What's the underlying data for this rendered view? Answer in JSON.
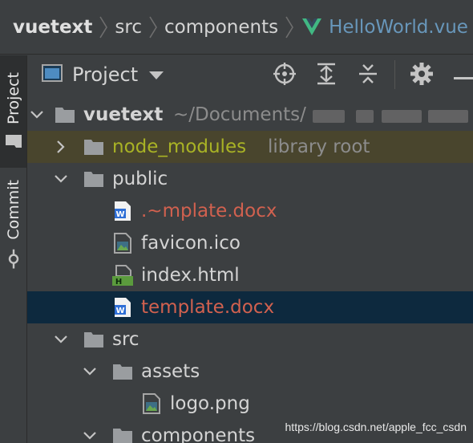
{
  "breadcrumb": {
    "items": [
      "vuetext",
      "src",
      "components",
      "HelloWorld.vue"
    ],
    "active_icon": "vue-logo-icon"
  },
  "tool_strip": {
    "project_label": "Project",
    "commit_label": "Commit"
  },
  "project_header": {
    "title": "Project",
    "view_icon": "project-view-icon",
    "actions": [
      "locate-icon",
      "expand-all-icon",
      "collapse-all-icon",
      "gear-icon",
      "hide-icon"
    ]
  },
  "tree": {
    "root": {
      "name": "vuetext",
      "path": "~/Documents/"
    },
    "rows": [
      {
        "name": "node_modules",
        "suffix": "library root",
        "kind": "folder-excluded",
        "state": "collapsed"
      },
      {
        "name": "public",
        "kind": "folder",
        "state": "expanded"
      },
      {
        "name": ".~mplate.docx",
        "kind": "word-file",
        "status": "unversioned"
      },
      {
        "name": "favicon.ico",
        "kind": "image-file"
      },
      {
        "name": "index.html",
        "kind": "html-file"
      },
      {
        "name": "template.docx",
        "kind": "word-file",
        "status": "unversioned",
        "selected": true
      },
      {
        "name": "src",
        "kind": "folder",
        "state": "expanded"
      },
      {
        "name": "assets",
        "kind": "folder",
        "state": "expanded"
      },
      {
        "name": "logo.png",
        "kind": "image-file"
      },
      {
        "name": "components",
        "kind": "folder",
        "state": "expanded"
      }
    ]
  },
  "colors": {
    "background": "#3c3f41",
    "selection": "#0d293e",
    "excluded_row": "#49452d",
    "unversioned_text": "#d1614f",
    "excluded_text": "#a9b325",
    "active_file_text": "#6897bb",
    "vue_green": "#41b883"
  },
  "watermark": "https://blog.csdn.net/apple_fcc_csdn"
}
